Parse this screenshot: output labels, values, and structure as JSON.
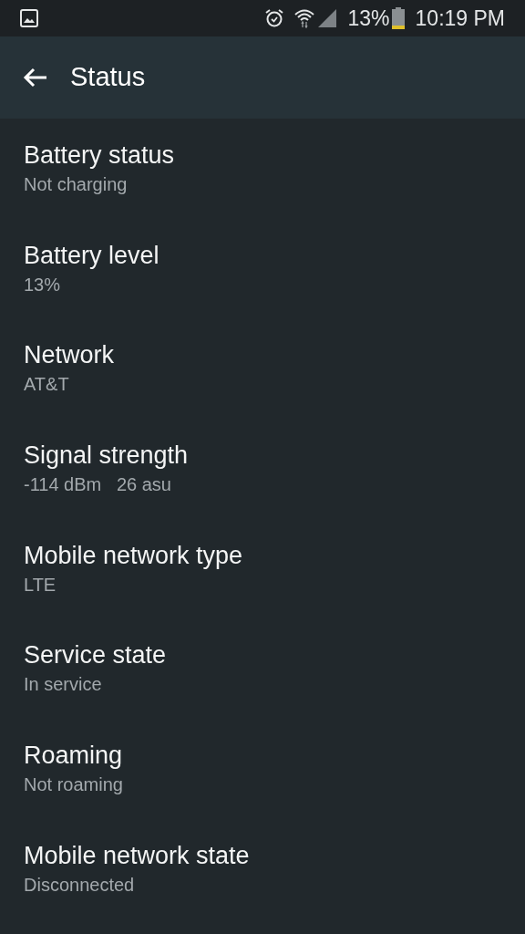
{
  "status_bar": {
    "battery": "13%",
    "time": "10:19 PM"
  },
  "app_bar": {
    "title": "Status"
  },
  "items": [
    {
      "title": "Battery status",
      "summary": "Not charging"
    },
    {
      "title": "Battery level",
      "summary": "13%"
    },
    {
      "title": "Network",
      "summary": "AT&T"
    },
    {
      "title": "Signal strength",
      "summary": "-114 dBm   26 asu"
    },
    {
      "title": "Mobile network type",
      "summary": "LTE"
    },
    {
      "title": "Service state",
      "summary": "In service"
    },
    {
      "title": "Roaming",
      "summary": "Not roaming"
    },
    {
      "title": "Mobile network state",
      "summary": "Disconnected"
    }
  ]
}
